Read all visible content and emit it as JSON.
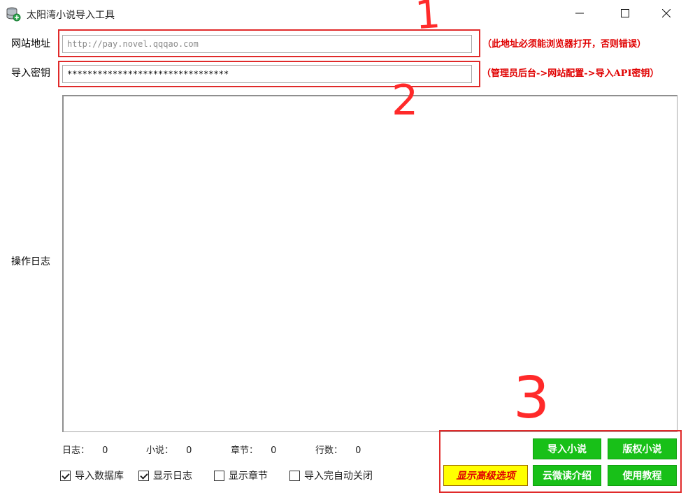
{
  "window": {
    "title": "太阳湾小说导入工具",
    "minimize_glyph": "—",
    "maximize_glyph": "☐",
    "close_glyph": "✕"
  },
  "form": {
    "site_label": "网站地址",
    "site_placeholder": "http://pay.novel.qqqao.com",
    "site_value": "",
    "site_hint": "（此地址必须能浏览器打开，否则错误）",
    "key_label": "导入密钥",
    "key_value": "********************************",
    "key_hint": "（管理员后台->网站配置->导入API密钥）",
    "log_label": "操作日志"
  },
  "stats": [
    {
      "label": "日志：",
      "value": "0"
    },
    {
      "label": "小说：",
      "value": "0"
    },
    {
      "label": "章节：",
      "value": "0"
    },
    {
      "label": "行数：",
      "value": "0"
    }
  ],
  "options": [
    {
      "label": "导入数据库",
      "checked": true
    },
    {
      "label": "显示日志",
      "checked": true
    },
    {
      "label": "显示章节",
      "checked": false
    },
    {
      "label": "导入完自动关闭",
      "checked": false
    }
  ],
  "buttons": {
    "import_novel": "导入小说",
    "copyright_novel": "版权小说",
    "advanced_options": "显示高级选项",
    "yunweidu_intro": "云微读介绍",
    "tutorial": "使用教程"
  },
  "annotations": {
    "mark_1": "1",
    "mark_2": "2",
    "mark_3": "3"
  },
  "colors": {
    "annotation_red": "#e02a2a",
    "green_button": "#18c018",
    "yellow_button": "#ffff00",
    "hint_red": "#e00000"
  }
}
